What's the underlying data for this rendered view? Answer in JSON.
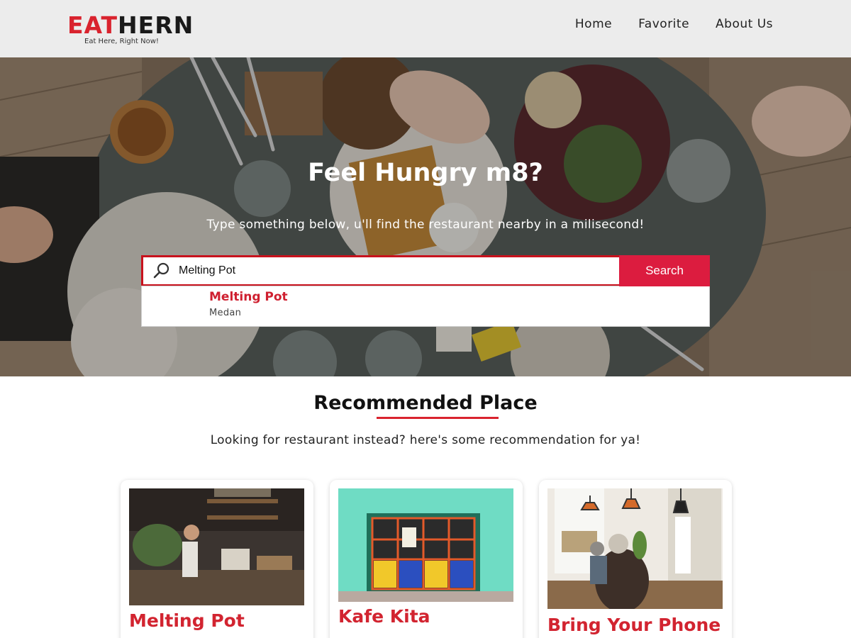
{
  "header": {
    "logo_red": "EAT",
    "logo_dark": "HERN",
    "tagline": "Eat Here, Right Now!",
    "nav": [
      {
        "label": "Home"
      },
      {
        "label": "Favorite"
      },
      {
        "label": "About Us"
      }
    ]
  },
  "hero": {
    "title": "Feel Hungry m8?",
    "subtitle": "Type something below, u'll find the restaurant nearby in a milisecond!",
    "search": {
      "value": "Melting Pot",
      "button_label": "Search"
    },
    "suggestion": {
      "name": "Melting Pot",
      "city": "Medan"
    }
  },
  "recommended": {
    "title": "Recommended Place",
    "subtitle": "Looking for restaurant instead? here's some recommendation for ya!",
    "cards": [
      {
        "name": "Melting Pot"
      },
      {
        "name": "Kafe Kita"
      },
      {
        "name": "Bring Your Phone"
      }
    ]
  },
  "colors": {
    "accent": "#d9232e",
    "button": "#dc1c3f",
    "header_bg": "#ececec"
  }
}
